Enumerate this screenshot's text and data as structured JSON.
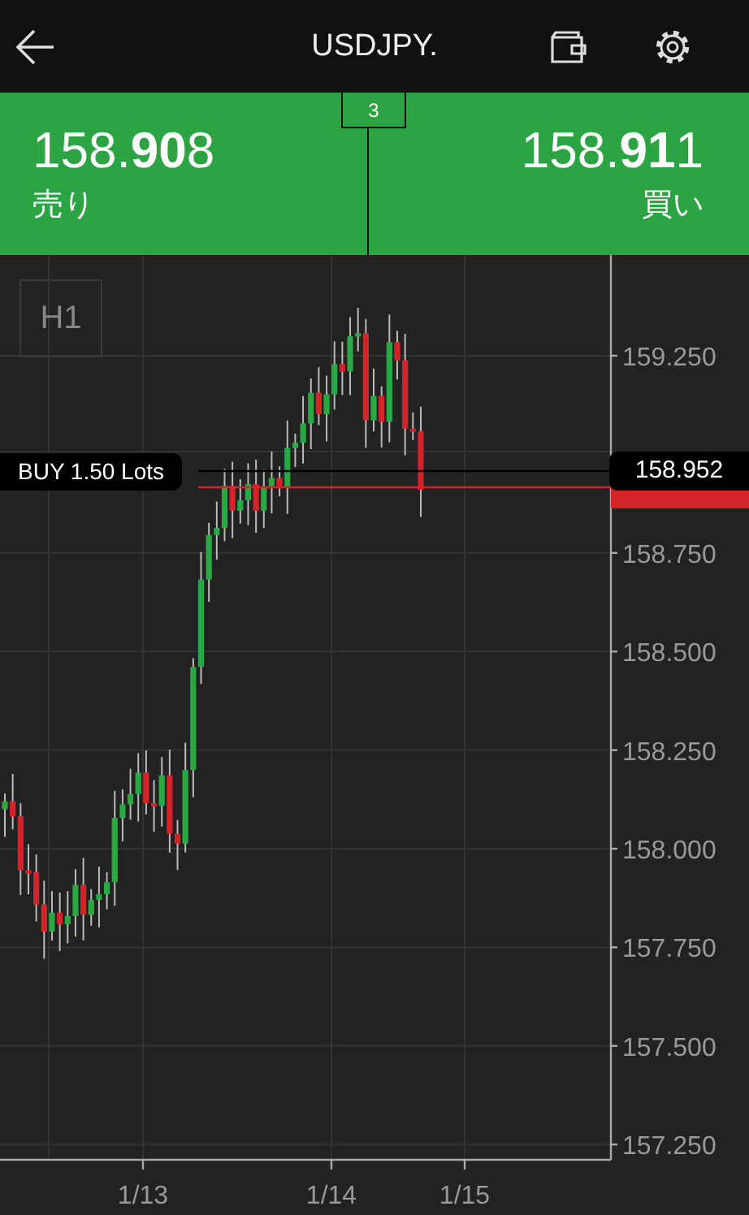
{
  "header": {
    "title": "USDJPY."
  },
  "quotes": {
    "badge": "3",
    "sell": {
      "price": "158.**90**8",
      "label": "売り"
    },
    "buy": {
      "price": "158.**91**1",
      "label": "買い"
    }
  },
  "chart": {
    "timeframe": "H1",
    "position": {
      "label": "BUY 1.50 Lots",
      "price": "158.952"
    },
    "y_labels": [
      "159.250",
      "158.750",
      "158.500",
      "158.250",
      "158.000",
      "157.750",
      "157.500",
      "157.250"
    ],
    "x_labels": [
      "1/13",
      "1/14",
      "1/15"
    ]
  }
}
